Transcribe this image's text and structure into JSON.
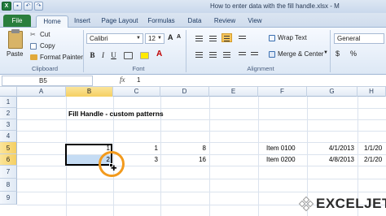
{
  "window": {
    "title": "How to enter data with the fill handle.xlsx - M",
    "qat": [
      "save-icon",
      "undo-icon",
      "redo-icon"
    ]
  },
  "tabs": [
    "File",
    "Home",
    "Insert",
    "Page Layout",
    "Formulas",
    "Data",
    "Review",
    "View"
  ],
  "ribbon": {
    "clipboard": {
      "paste": "Paste",
      "cut": "Cut",
      "copy": "Copy",
      "format_painter": "Format Painter",
      "label": "Clipboard"
    },
    "font": {
      "name": "Calibri",
      "size": "12",
      "bold": "B",
      "italic": "I",
      "underline": "U",
      "label": "Font"
    },
    "alignment": {
      "wrap_text": "Wrap Text",
      "merge_center": "Merge & Center",
      "label": "Alignment"
    },
    "number": {
      "format": "General",
      "currency": "$",
      "percent": "%"
    }
  },
  "formula_bar": {
    "name_box": "B5",
    "fx": "fx",
    "value": "1"
  },
  "columns": [
    "A",
    "B",
    "C",
    "D",
    "E",
    "F",
    "G",
    "H"
  ],
  "rows": [
    "1",
    "2",
    "3",
    "4",
    "5",
    "6",
    "7",
    "8",
    "9"
  ],
  "sheet": {
    "title": "Fill Handle - custom patterns",
    "b5": "1",
    "b6": "2",
    "c5": "1",
    "c6": "3",
    "d5": "8",
    "d6": "16",
    "f5": "Item 0100",
    "f6": "Item 0200",
    "g5": "4/1/2013",
    "g6": "4/8/2013",
    "h5": "1/1/20",
    "h6": "2/1/20"
  },
  "logo": "EXCELJET",
  "colors": {
    "file_tab": "#2a7e3d",
    "accent_ring": "#f29a1d",
    "selection_fill": "#c5dcf4",
    "header_selected": "#f5cf62"
  }
}
